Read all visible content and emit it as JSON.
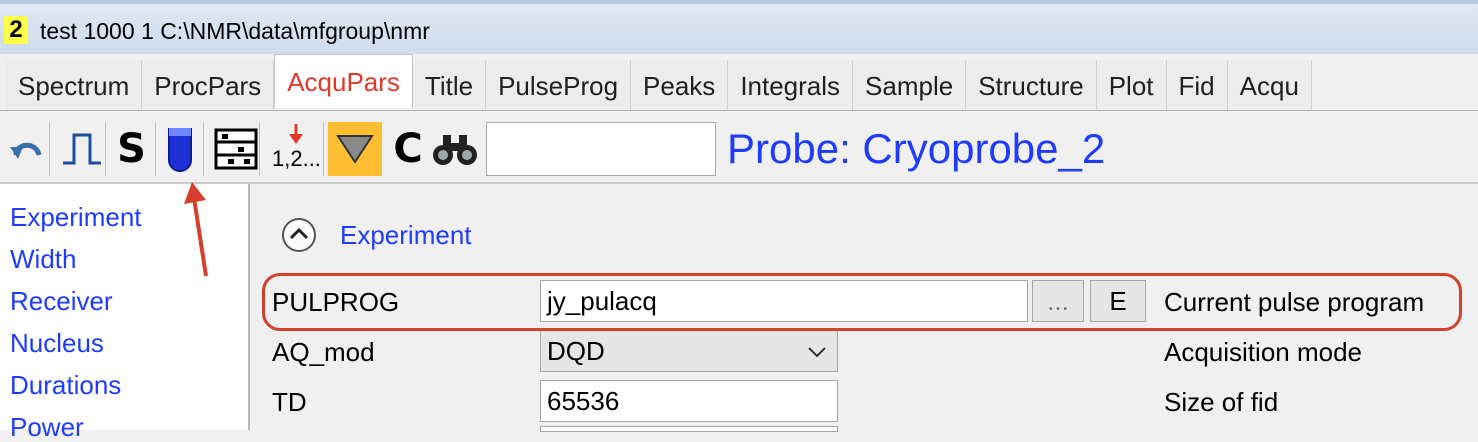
{
  "window": {
    "number": "2",
    "title": "test  1000  1  C:\\NMR\\data\\mfgroup\\nmr"
  },
  "tabs": [
    "Spectrum",
    "ProcPars",
    "AcquPars",
    "Title",
    "PulseProg",
    "Peaks",
    "Integrals",
    "Sample",
    "Structure",
    "Plot",
    "Fid",
    "Acqu"
  ],
  "active_tab": "AcquPars",
  "toolbar": {
    "s_label": "S",
    "numbering_label": "1,2...",
    "c_label": "C",
    "search_value": "",
    "probe_label": "Probe: Cryoprobe_2"
  },
  "sidebar": {
    "items": [
      "Experiment",
      "Width",
      "Receiver",
      "Nucleus",
      "Durations",
      "Power"
    ]
  },
  "section": {
    "title": "Experiment"
  },
  "params": [
    {
      "name": "PULPROG",
      "value": "jy_pulacq",
      "desc": "Current pulse program",
      "browse_label": "...",
      "edit_label": "E"
    },
    {
      "name": "AQ_mod",
      "value": "DQD",
      "desc": "Acquisition mode"
    },
    {
      "name": "TD",
      "value": "65536",
      "desc": "Size of fid"
    }
  ],
  "colors": {
    "link_blue": "#1f3bff",
    "active_tab": "#e0392b",
    "annotation_red": "#d3402b",
    "highlight_orange": "#ffbf33"
  }
}
